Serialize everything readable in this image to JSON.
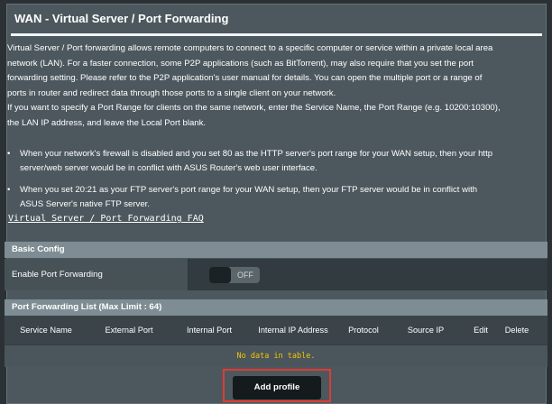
{
  "page": {
    "title": "WAN - Virtual Server / Port Forwarding"
  },
  "description": {
    "p1_line1": "Virtual Server / Port forwarding allows remote computers to connect to a specific computer or service within a private local area",
    "p1_line2": "network (LAN). For a faster connection, some P2P applications (such as BitTorrent), may also require that you set the port",
    "p1_line3": "forwarding setting. Please refer to the P2P application's user manual for details. You can open the multiple port or a range of",
    "p1_line4": "ports in router and redirect data through those ports to a single client on your network.",
    "p2_line1": "If you want to specify a Port Range for clients on the same network, enter the Service Name, the Port Range (e.g. 10200:10300),",
    "p2_line2": "the LAN IP address, and leave the Local Port blank."
  },
  "notes": [
    {
      "bullet": "•",
      "line1": "When your network's firewall is disabled and you set 80 as the HTTP server's port range for your WAN setup, then your http",
      "line2": "server/web server would be in conflict with ASUS Router's web user interface."
    },
    {
      "bullet": "•",
      "line1": "When you set 20:21 as your FTP server's port range for your WAN setup, then your FTP server would be in conflict with",
      "line2": "ASUS Server's native FTP server."
    }
  ],
  "faq_link": "Virtual Server / Port Forwarding FAQ",
  "basic_config": {
    "header": "Basic Config",
    "enable_label": "Enable Port Forwarding",
    "toggle_state": "OFF"
  },
  "pf_list": {
    "header": "Port Forwarding List (Max Limit : 64)",
    "columns": [
      "Service Name",
      "External Port",
      "Internal Port",
      "Internal IP Address",
      "Protocol",
      "Source IP",
      "Edit",
      "Delete"
    ],
    "empty_message": "No data in table."
  },
  "add_profile_label": "Add profile",
  "colors": {
    "panel_bg": "#4c585e",
    "section_header": "#7e8d93",
    "empty_text": "#f5c400",
    "highlight_border": "#e23a32"
  }
}
